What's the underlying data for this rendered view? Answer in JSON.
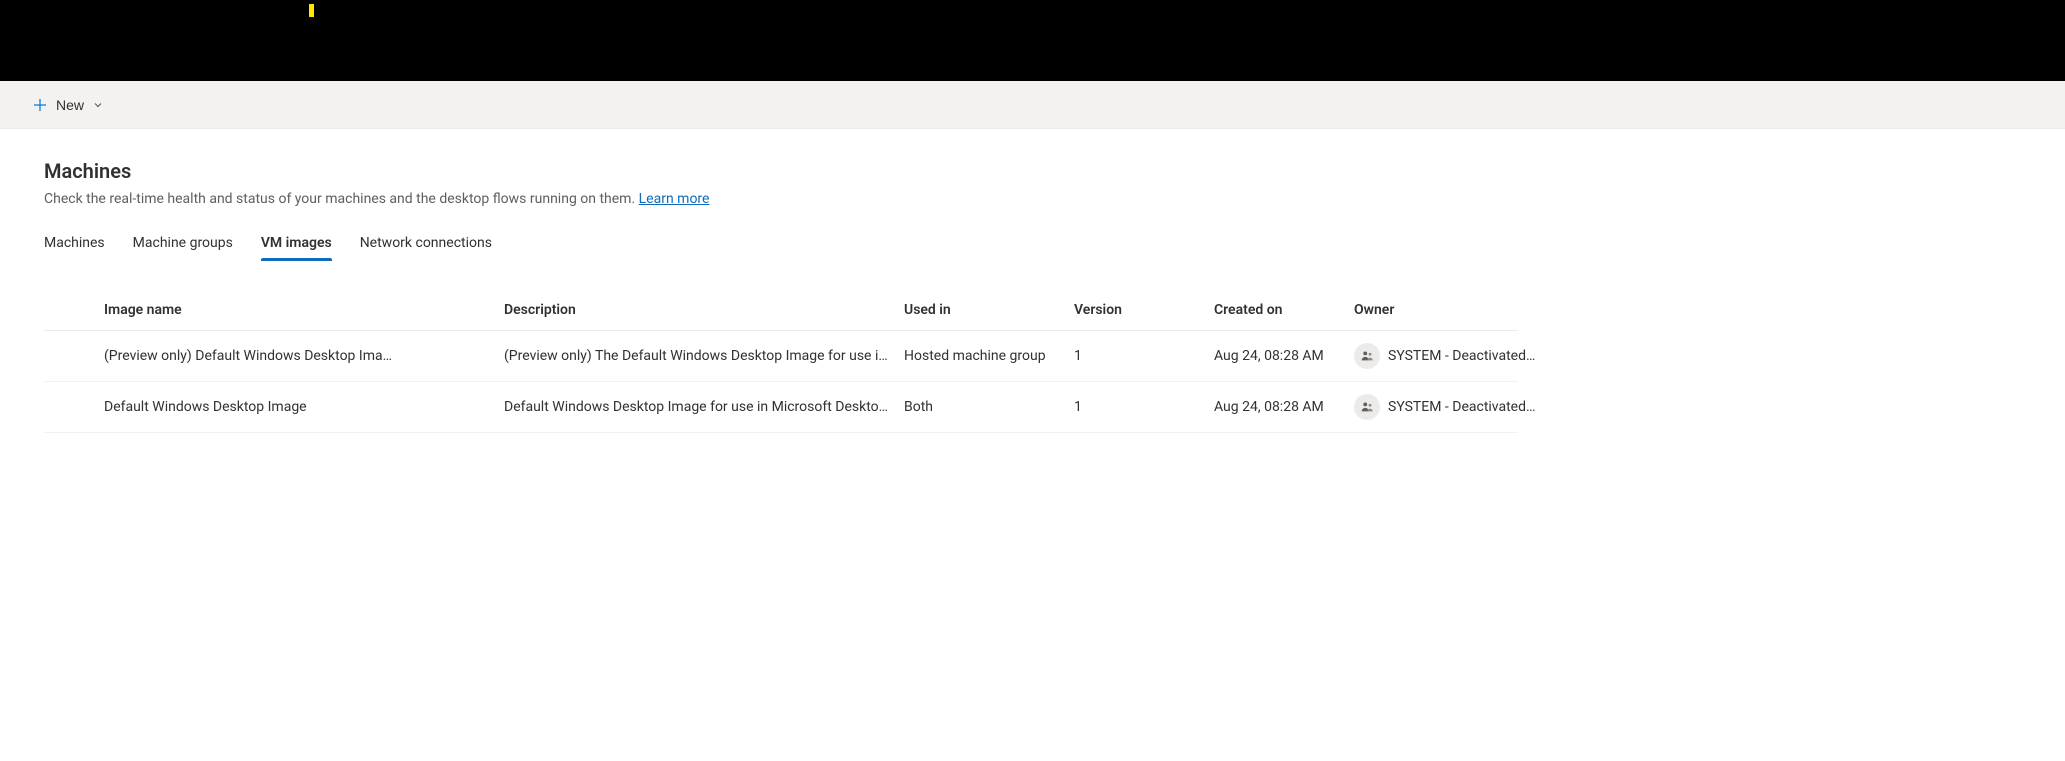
{
  "commandBar": {
    "newLabel": "New"
  },
  "header": {
    "title": "Machines",
    "subtitle": "Check the real-time health and status of your machines and the desktop flows running on them.",
    "learnMore": "Learn more"
  },
  "tabs": [
    {
      "label": "Machines",
      "active": false
    },
    {
      "label": "Machine groups",
      "active": false
    },
    {
      "label": "VM images",
      "active": true
    },
    {
      "label": "Network connections",
      "active": false
    }
  ],
  "columns": {
    "imageName": "Image name",
    "description": "Description",
    "usedIn": "Used in",
    "version": "Version",
    "createdOn": "Created on",
    "owner": "Owner"
  },
  "rows": [
    {
      "imageName": "(Preview only) Default Windows Desktop Ima…",
      "description": "(Preview only) The Default Windows Desktop Image for use i…",
      "usedIn": "Hosted machine group",
      "version": "1",
      "createdOn": "Aug 24, 08:28 AM",
      "owner": "SYSTEM - Deactivated…"
    },
    {
      "imageName": "Default Windows Desktop Image",
      "description": "Default Windows Desktop Image for use in Microsoft Deskto…",
      "usedIn": "Both",
      "version": "1",
      "createdOn": "Aug 24, 08:28 AM",
      "owner": "SYSTEM - Deactivated…"
    }
  ]
}
